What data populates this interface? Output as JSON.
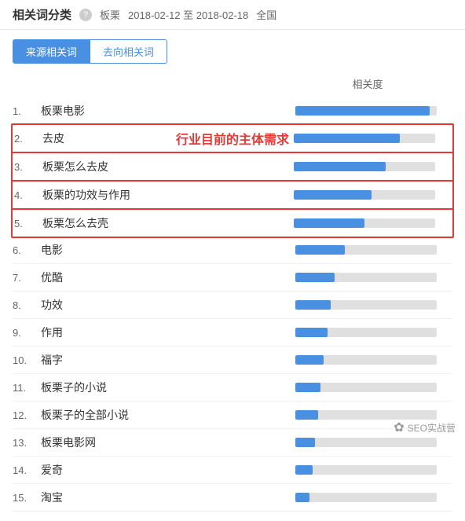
{
  "header": {
    "title": "相关词分类",
    "help_icon": "?",
    "keyword": "板栗",
    "date_range": "2018-02-12 至 2018-02-18",
    "region": "全国"
  },
  "tabs": [
    {
      "id": "source",
      "label": "来源相关词",
      "active": true
    },
    {
      "id": "target",
      "label": "去向相关词",
      "active": false
    }
  ],
  "relatedness_col": "相关度",
  "annotation": "行业目前的主体需求",
  "keywords": [
    {
      "num": "1.",
      "text": "板栗电影",
      "bar": 95,
      "highlight": false
    },
    {
      "num": "2.",
      "text": "去皮",
      "bar": 75,
      "highlight": true
    },
    {
      "num": "3.",
      "text": "板栗怎么去皮",
      "bar": 65,
      "highlight": true
    },
    {
      "num": "4.",
      "text": "板栗的功效与作用",
      "bar": 55,
      "highlight": true
    },
    {
      "num": "5.",
      "text": "板栗怎么去壳",
      "bar": 50,
      "highlight": true
    },
    {
      "num": "6.",
      "text": "电影",
      "bar": 35,
      "highlight": false
    },
    {
      "num": "7.",
      "text": "优酷",
      "bar": 28,
      "highlight": false
    },
    {
      "num": "8.",
      "text": "功效",
      "bar": 25,
      "highlight": false
    },
    {
      "num": "9.",
      "text": "作用",
      "bar": 23,
      "highlight": false
    },
    {
      "num": "10.",
      "text": "福字",
      "bar": 20,
      "highlight": false
    },
    {
      "num": "11.",
      "text": "板栗子的小说",
      "bar": 18,
      "highlight": false
    },
    {
      "num": "12.",
      "text": "板栗子的全部小说",
      "bar": 16,
      "highlight": false
    },
    {
      "num": "13.",
      "text": "板栗电影网",
      "bar": 14,
      "highlight": false
    },
    {
      "num": "14.",
      "text": "爱奇",
      "bar": 12,
      "highlight": false
    },
    {
      "num": "15.",
      "text": "淘宝",
      "bar": 10,
      "highlight": false
    }
  ],
  "watermark": "SEO实战营"
}
